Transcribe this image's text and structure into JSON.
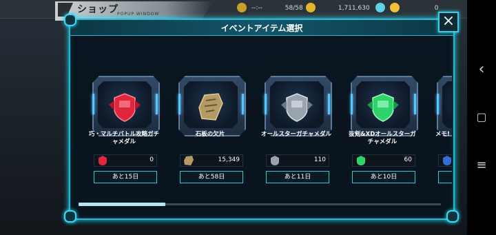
{
  "header": {
    "shop_title": "ショップ",
    "shop_subtitle": "POPUP WINDOW",
    "stamina": "58/58",
    "stamina_extra": "--:--",
    "coins": "1,711,630",
    "gems": "0"
  },
  "modal": {
    "title": "イベントアイテム選択",
    "close_label": "×"
  },
  "items": [
    {
      "name": "巧・マルチバトル攻略ガチャメダル",
      "count": "0",
      "remain": "あと15日",
      "color": "#e0263b"
    },
    {
      "name": "石板の欠片",
      "count": "15,349",
      "remain": "あと58日",
      "color": "#b49a64"
    },
    {
      "name": "オールスターガチャメダル",
      "count": "110",
      "remain": "あと11日",
      "color": "#9aa3ad"
    },
    {
      "name": "抜剣&XDオールスターガチャメダル",
      "count": "60",
      "remain": "あと10日",
      "color": "#2ed36a"
    },
    {
      "name": "メモ!",
      "count": "",
      "remain": "",
      "color": "#2f6fd6"
    }
  ],
  "nav": {
    "back": "‹",
    "home": "▢",
    "menu": "≡"
  }
}
